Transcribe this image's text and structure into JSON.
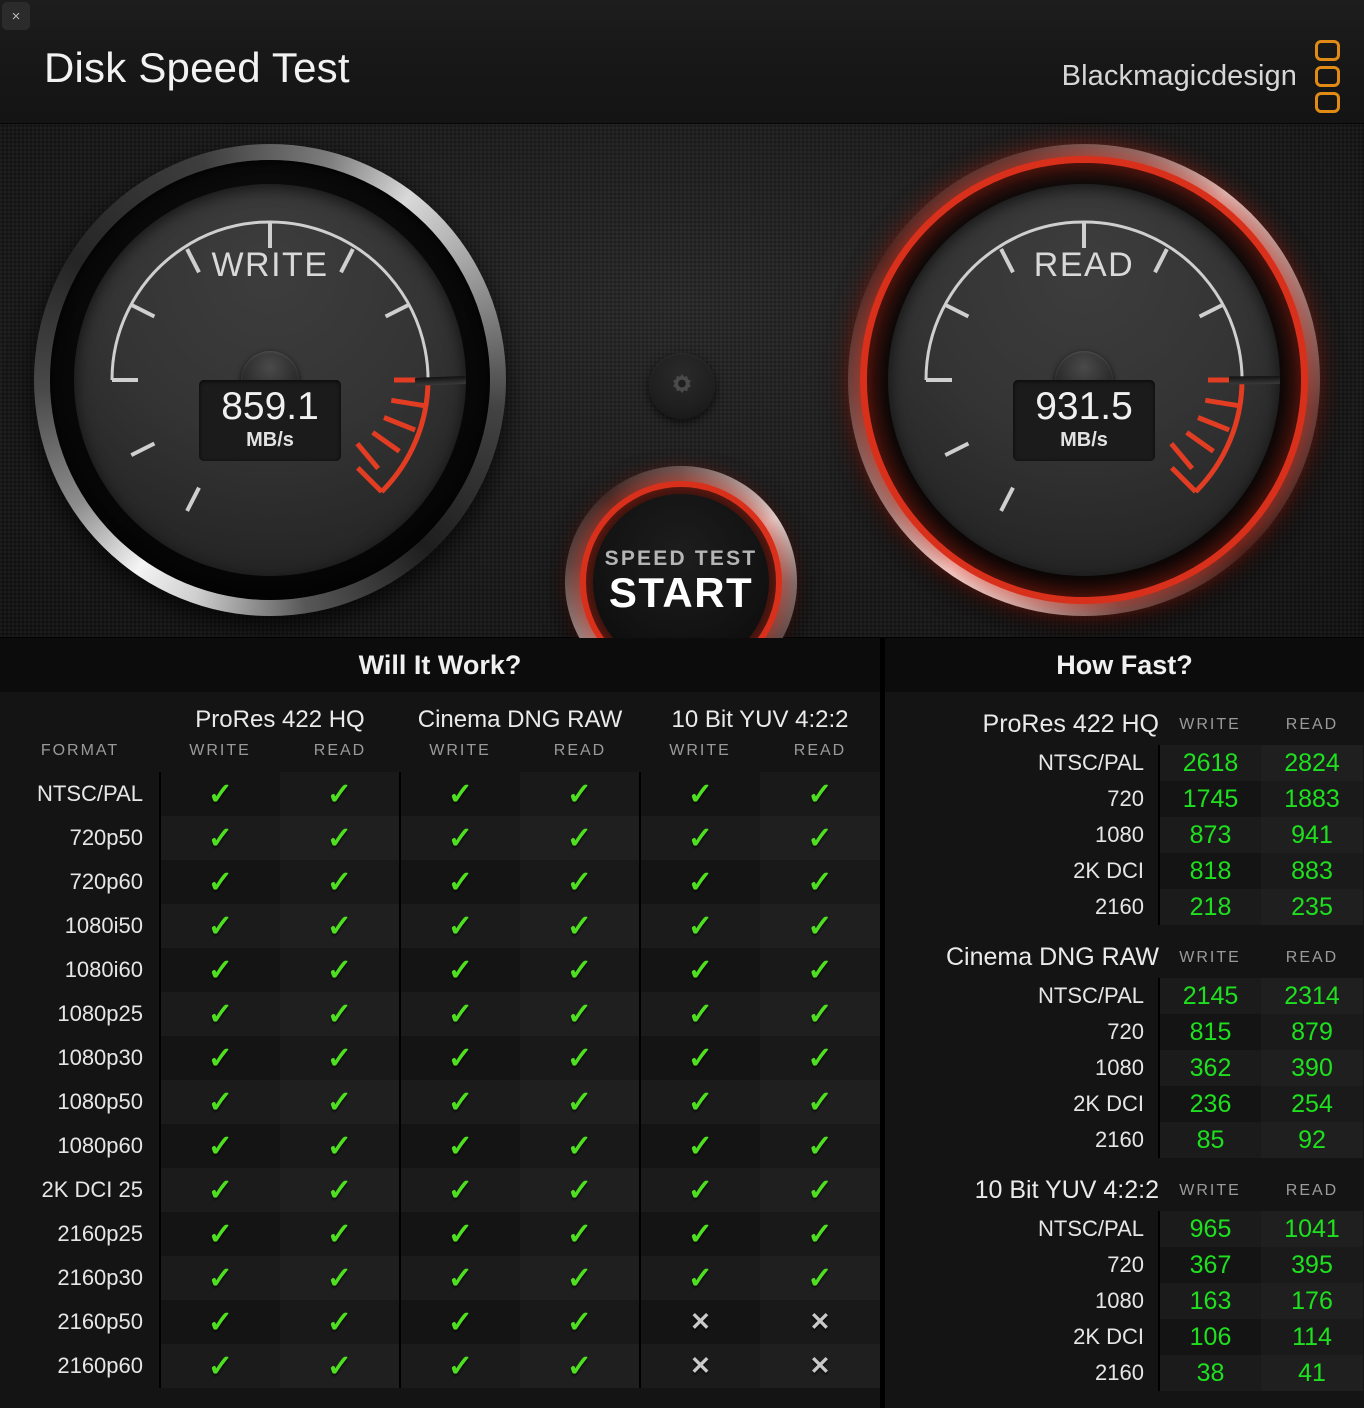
{
  "window": {
    "close_label": "×",
    "title": "Disk Speed Test"
  },
  "brand": {
    "name": "Blackmagicdesign",
    "accent": "#e08b16"
  },
  "gauges": {
    "write": {
      "label": "WRITE",
      "value": "859.1",
      "unit": "MB/s",
      "needle_color": "#2bc0f4",
      "active": false
    },
    "read": {
      "label": "READ",
      "value": "931.5",
      "unit": "MB/s",
      "needle_color": "#2bc0f4",
      "active": true
    }
  },
  "controls": {
    "gear_icon": "gear-icon",
    "start_sub": "SPEED TEST",
    "start_main": "START",
    "ring_color": "#d8301a"
  },
  "will_it_work": {
    "title": "Will It Work?",
    "format_header": "FORMAT",
    "codecs": [
      "ProRes 422 HQ",
      "Cinema DNG RAW",
      "10 Bit YUV 4:2:2"
    ],
    "sub_headers": [
      "WRITE",
      "READ"
    ],
    "pass_icon": "✓",
    "fail_icon": "✕",
    "rows": [
      {
        "format": "NTSC/PAL",
        "cells": [
          true,
          true,
          true,
          true,
          true,
          true
        ]
      },
      {
        "format": "720p50",
        "cells": [
          true,
          true,
          true,
          true,
          true,
          true
        ]
      },
      {
        "format": "720p60",
        "cells": [
          true,
          true,
          true,
          true,
          true,
          true
        ]
      },
      {
        "format": "1080i50",
        "cells": [
          true,
          true,
          true,
          true,
          true,
          true
        ]
      },
      {
        "format": "1080i60",
        "cells": [
          true,
          true,
          true,
          true,
          true,
          true
        ]
      },
      {
        "format": "1080p25",
        "cells": [
          true,
          true,
          true,
          true,
          true,
          true
        ]
      },
      {
        "format": "1080p30",
        "cells": [
          true,
          true,
          true,
          true,
          true,
          true
        ]
      },
      {
        "format": "1080p50",
        "cells": [
          true,
          true,
          true,
          true,
          true,
          true
        ]
      },
      {
        "format": "1080p60",
        "cells": [
          true,
          true,
          true,
          true,
          true,
          true
        ]
      },
      {
        "format": "2K DCI 25",
        "cells": [
          true,
          true,
          true,
          true,
          true,
          true
        ]
      },
      {
        "format": "2160p25",
        "cells": [
          true,
          true,
          true,
          true,
          true,
          true
        ]
      },
      {
        "format": "2160p30",
        "cells": [
          true,
          true,
          true,
          true,
          true,
          true
        ]
      },
      {
        "format": "2160p50",
        "cells": [
          true,
          true,
          true,
          true,
          false,
          false
        ]
      },
      {
        "format": "2160p60",
        "cells": [
          true,
          true,
          true,
          true,
          false,
          false
        ]
      }
    ]
  },
  "how_fast": {
    "title": "How Fast?",
    "col_write": "WRITE",
    "col_read": "READ",
    "groups": [
      {
        "codec": "ProRes 422 HQ",
        "rows": [
          {
            "label": "NTSC/PAL",
            "write": "2618",
            "read": "2824"
          },
          {
            "label": "720",
            "write": "1745",
            "read": "1883"
          },
          {
            "label": "1080",
            "write": "873",
            "read": "941"
          },
          {
            "label": "2K DCI",
            "write": "818",
            "read": "883"
          },
          {
            "label": "2160",
            "write": "218",
            "read": "235"
          }
        ]
      },
      {
        "codec": "Cinema DNG RAW",
        "rows": [
          {
            "label": "NTSC/PAL",
            "write": "2145",
            "read": "2314"
          },
          {
            "label": "720",
            "write": "815",
            "read": "879"
          },
          {
            "label": "1080",
            "write": "362",
            "read": "390"
          },
          {
            "label": "2K DCI",
            "write": "236",
            "read": "254"
          },
          {
            "label": "2160",
            "write": "85",
            "read": "92"
          }
        ]
      },
      {
        "codec": "10 Bit YUV 4:2:2",
        "rows": [
          {
            "label": "NTSC/PAL",
            "write": "965",
            "read": "1041"
          },
          {
            "label": "720",
            "write": "367",
            "read": "395"
          },
          {
            "label": "1080",
            "write": "163",
            "read": "176"
          },
          {
            "label": "2K DCI",
            "write": "106",
            "read": "114"
          },
          {
            "label": "2160",
            "write": "38",
            "read": "41"
          }
        ]
      }
    ]
  }
}
